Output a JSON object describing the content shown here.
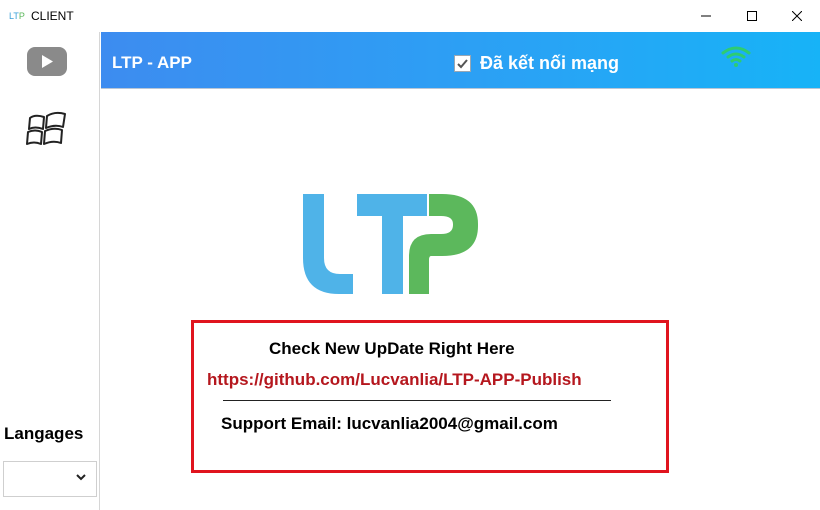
{
  "window": {
    "icon_text_a": "LT",
    "icon_text_b": "P",
    "title": "CLIENT"
  },
  "header": {
    "app_name": "LTP - APP",
    "network_label": "Đã kết nối mạng",
    "network_checked": true
  },
  "sidebar": {
    "languages_label": "Langages",
    "language_selected": ""
  },
  "update": {
    "title": "Check New UpDate Right Here",
    "link": "https://github.com/Lucvanlia/LTP-APP-Publish",
    "support": "Support Email: lucvanlia2004@gmail.com"
  },
  "colors": {
    "header_gradient_start": "#3d8cf0",
    "header_gradient_end": "#17b3f7",
    "logo_blue": "#4fb3e8",
    "logo_green": "#5cb85c",
    "link_red": "#b5171e",
    "box_border": "#e0141e",
    "wifi_green": "#2ecc71"
  },
  "icons": {
    "youtube": "youtube-play-icon",
    "windows": "windows-logo-icon",
    "wifi": "wifi-icon",
    "minimize": "minimize-icon",
    "maximize": "maximize-icon",
    "close": "close-icon",
    "dropdown": "chevron-down-icon"
  }
}
